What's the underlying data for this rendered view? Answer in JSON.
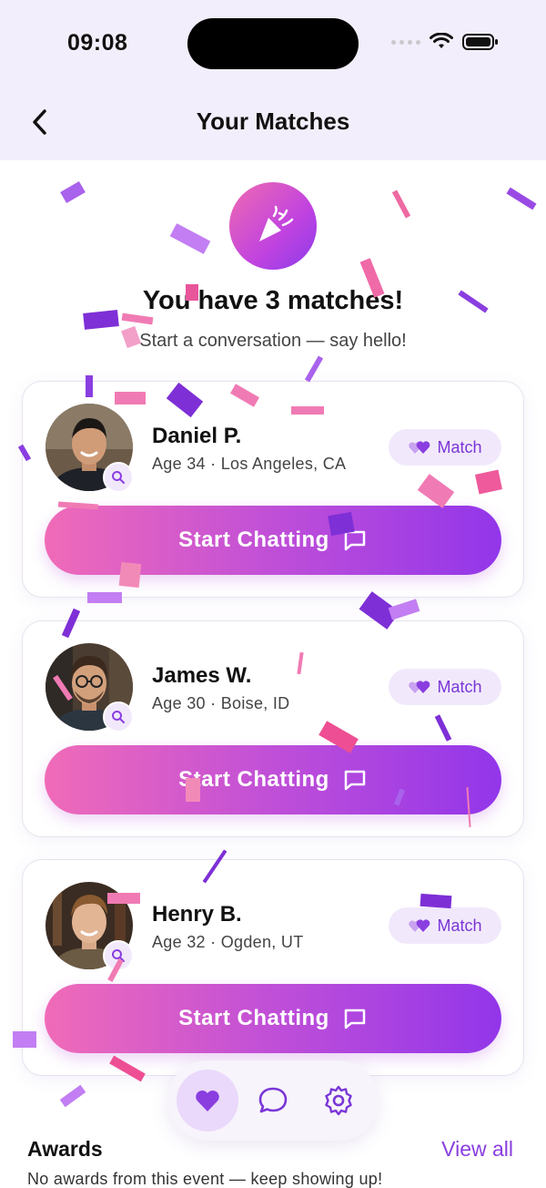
{
  "status_bar": {
    "time": "09:08"
  },
  "nav": {
    "title": "Your Matches",
    "back_label": "back"
  },
  "hero": {
    "headline": "You have 3 matches!",
    "subtitle": "Start a conversation — say hello!"
  },
  "matches": [
    {
      "name": "Daniel P.",
      "meta": "Age 34 · Los Angeles, CA",
      "badge": "Match",
      "button": "Start Chatting"
    },
    {
      "name": "James W.",
      "meta": "Age 30 · Boise, ID",
      "badge": "Match",
      "button": "Start Chatting"
    },
    {
      "name": "Henry B.",
      "meta": "Age 32 · Ogden, UT",
      "badge": "Match",
      "button": "Start Chatting"
    }
  ],
  "tabbar": {
    "active": "matches",
    "icons": [
      "heart-icon",
      "chat-bubble-icon",
      "gear-icon"
    ]
  },
  "awards": {
    "title": "Awards",
    "view_all": "View all",
    "empty_text": "No awards from this event — keep showing up!"
  },
  "colors": {
    "accent": "#8a3ee0",
    "gradient_start": "#f06bb8",
    "gradient_end": "#9236ea",
    "topbar_bg": "#f3eefb",
    "badge_bg": "#f1e9fb"
  }
}
